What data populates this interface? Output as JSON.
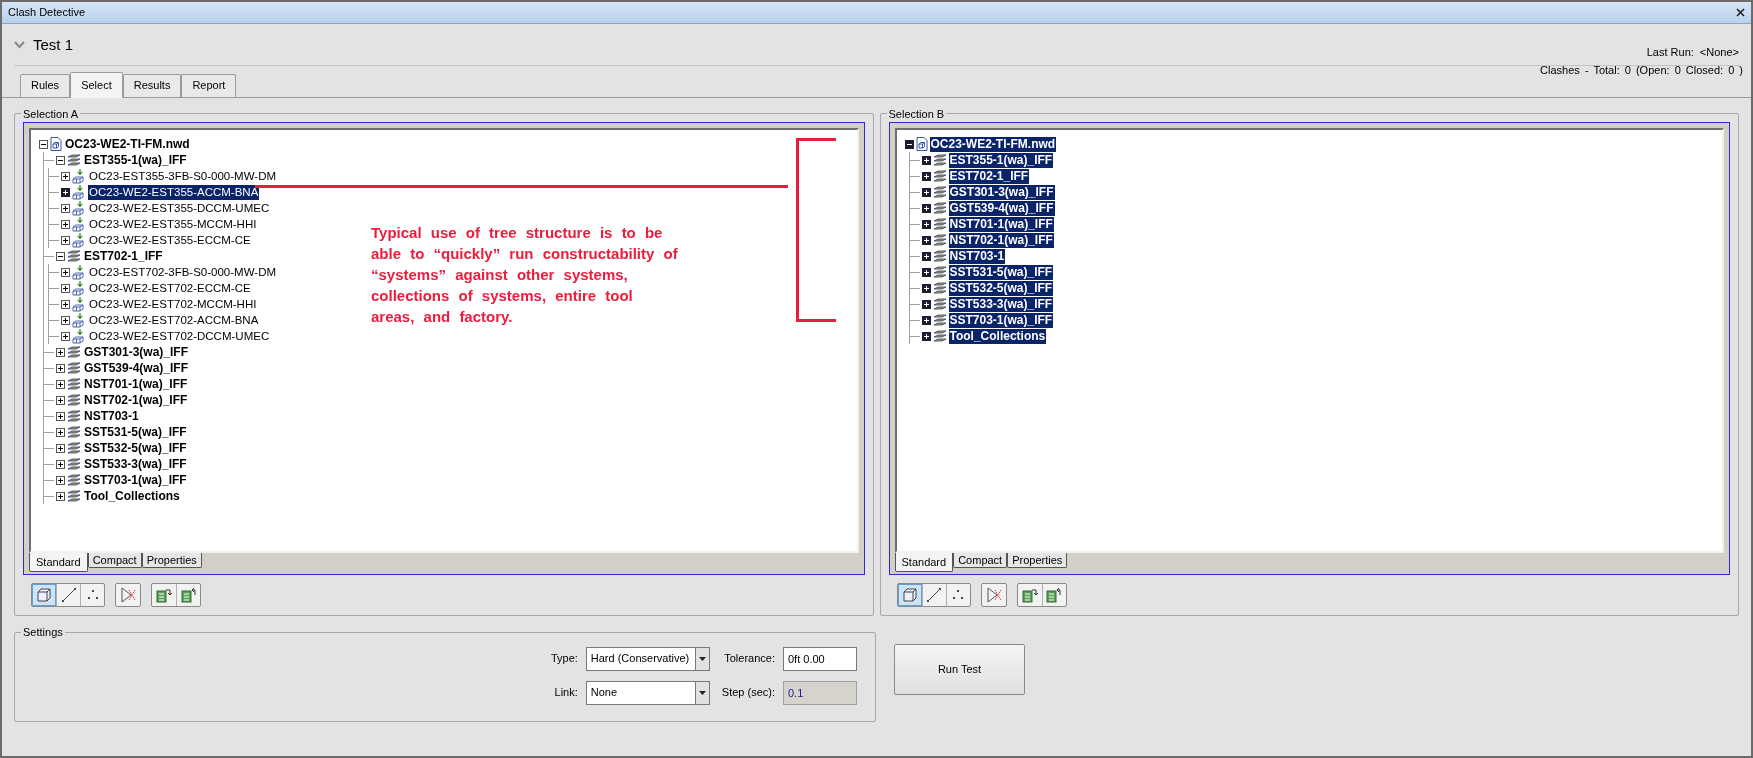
{
  "window": {
    "title": "Clash Detective"
  },
  "test": {
    "name": "Test 1",
    "expanded": true
  },
  "last_run": {
    "label": "Last Run:",
    "value": "<None>"
  },
  "clashes_summary": "Clashes - Total: 0 (Open: 0 Closed: 0 )",
  "tabs": [
    {
      "label": "Rules",
      "selected": false
    },
    {
      "label": "Select",
      "selected": true
    },
    {
      "label": "Results",
      "selected": false
    },
    {
      "label": "Report",
      "selected": false
    }
  ],
  "selection_a": {
    "title": "Selection A",
    "tree": [
      {
        "label": "OC23-WE2-TI-FM.nwd",
        "kind": "file",
        "expanded": true,
        "selected": false,
        "children": [
          {
            "label": "EST355-1(wa)_IFF",
            "kind": "layer",
            "expanded": true,
            "selected": false,
            "children": [
              {
                "label": "OC23-EST355-3FB-S0-000-MW-DM",
                "kind": "model",
                "expanded": false,
                "selected": false
              },
              {
                "label": "OC23-WE2-EST355-ACCM-BNA",
                "kind": "model",
                "expanded": false,
                "selected": true
              },
              {
                "label": "OC23-WE2-EST355-DCCM-UMEC",
                "kind": "model",
                "expanded": false,
                "selected": false
              },
              {
                "label": "OC23-WE2-EST355-MCCM-HHI",
                "kind": "model",
                "expanded": false,
                "selected": false
              },
              {
                "label": "OC23-WE2-EST355-ECCM-CE",
                "kind": "model",
                "expanded": false,
                "selected": false
              }
            ]
          },
          {
            "label": "EST702-1_IFF",
            "kind": "layer",
            "expanded": true,
            "selected": false,
            "children": [
              {
                "label": "OC23-EST702-3FB-S0-000-MW-DM",
                "kind": "model",
                "expanded": false,
                "selected": false
              },
              {
                "label": "OC23-WE2-EST702-ECCM-CE",
                "kind": "model",
                "expanded": false,
                "selected": false
              },
              {
                "label": "OC23-WE2-EST702-MCCM-HHI",
                "kind": "model",
                "expanded": false,
                "selected": false
              },
              {
                "label": "OC23-WE2-EST702-ACCM-BNA",
                "kind": "model",
                "expanded": false,
                "selected": false
              },
              {
                "label": "OC23-WE2-EST702-DCCM-UMEC",
                "kind": "model",
                "expanded": false,
                "selected": false
              }
            ]
          },
          {
            "label": "GST301-3(wa)_IFF",
            "kind": "layer",
            "expanded": false,
            "selected": false
          },
          {
            "label": "GST539-4(wa)_IFF",
            "kind": "layer",
            "expanded": false,
            "selected": false
          },
          {
            "label": "NST701-1(wa)_IFF",
            "kind": "layer",
            "expanded": false,
            "selected": false
          },
          {
            "label": "NST702-1(wa)_IFF",
            "kind": "layer",
            "expanded": false,
            "selected": false
          },
          {
            "label": "NST703-1",
            "kind": "layer",
            "expanded": false,
            "selected": false
          },
          {
            "label": "SST531-5(wa)_IFF",
            "kind": "layer",
            "expanded": false,
            "selected": false
          },
          {
            "label": "SST532-5(wa)_IFF",
            "kind": "layer",
            "expanded": false,
            "selected": false
          },
          {
            "label": "SST533-3(wa)_IFF",
            "kind": "layer",
            "expanded": false,
            "selected": false
          },
          {
            "label": "SST703-1(wa)_IFF",
            "kind": "layer",
            "expanded": false,
            "selected": false
          },
          {
            "label": "Tool_Collections",
            "kind": "layer",
            "expanded": false,
            "selected": false
          }
        ]
      }
    ],
    "view_tabs": [
      {
        "label": "Standard",
        "selected": true
      },
      {
        "label": "Compact",
        "selected": false
      },
      {
        "label": "Properties",
        "selected": false
      }
    ],
    "toolbar": [
      {
        "kind": "box",
        "selected": true
      },
      {
        "kind": "line",
        "selected": false
      },
      {
        "kind": "points",
        "selected": false
      },
      {
        "kind": "self",
        "selected": false
      },
      {
        "kind": "import",
        "selected": false
      },
      {
        "kind": "export",
        "selected": false
      }
    ]
  },
  "annotation": {
    "text": "Typical use of tree structure is to be\nable to “quickly” run constructability of\n “systems” against other systems,\ncollections of systems, entire tool\nareas, and factory."
  },
  "selection_b": {
    "title": "Selection B",
    "tree": [
      {
        "label": "OC23-WE2-TI-FM.nwd",
        "kind": "file",
        "expanded": true,
        "selected": true,
        "children": [
          {
            "label": "EST355-1(wa)_IFF",
            "kind": "layer",
            "expanded": false,
            "selected": true
          },
          {
            "label": "EST702-1_IFF",
            "kind": "layer",
            "expanded": false,
            "selected": true
          },
          {
            "label": "GST301-3(wa)_IFF",
            "kind": "layer",
            "expanded": false,
            "selected": true
          },
          {
            "label": "GST539-4(wa)_IFF",
            "kind": "layer",
            "expanded": false,
            "selected": true
          },
          {
            "label": "NST701-1(wa)_IFF",
            "kind": "layer",
            "expanded": false,
            "selected": true
          },
          {
            "label": "NST702-1(wa)_IFF",
            "kind": "layer",
            "expanded": false,
            "selected": true
          },
          {
            "label": "NST703-1",
            "kind": "layer",
            "expanded": false,
            "selected": true
          },
          {
            "label": "SST531-5(wa)_IFF",
            "kind": "layer",
            "expanded": false,
            "selected": true
          },
          {
            "label": "SST532-5(wa)_IFF",
            "kind": "layer",
            "expanded": false,
            "selected": true
          },
          {
            "label": "SST533-3(wa)_IFF",
            "kind": "layer",
            "expanded": false,
            "selected": true
          },
          {
            "label": "SST703-1(wa)_IFF",
            "kind": "layer",
            "expanded": false,
            "selected": true
          },
          {
            "label": "Tool_Collections",
            "kind": "layer",
            "expanded": false,
            "selected": true
          }
        ]
      }
    ],
    "view_tabs": [
      {
        "label": "Standard",
        "selected": true
      },
      {
        "label": "Compact",
        "selected": false
      },
      {
        "label": "Properties",
        "selected": false
      }
    ],
    "toolbar": [
      {
        "kind": "box",
        "selected": true
      },
      {
        "kind": "line",
        "selected": false
      },
      {
        "kind": "points",
        "selected": false
      },
      {
        "kind": "self",
        "selected": false
      },
      {
        "kind": "import",
        "selected": false
      },
      {
        "kind": "export",
        "selected": false
      }
    ]
  },
  "settings": {
    "title": "Settings",
    "type": {
      "label": "Type:",
      "value": "Hard (Conservative)"
    },
    "tolerance": {
      "label": "Tolerance:",
      "value": "0ft 0.00"
    },
    "link": {
      "label": "Link:",
      "value": "None"
    },
    "step": {
      "label": "Step (sec):",
      "value": "0.1",
      "disabled": true
    }
  },
  "run_button": "Run Test"
}
